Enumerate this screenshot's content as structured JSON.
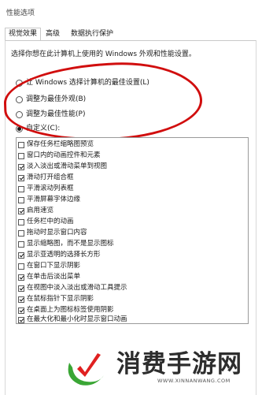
{
  "window": {
    "title": "性能选项"
  },
  "tabs": [
    {
      "label": "视觉效果",
      "active": true
    },
    {
      "label": "高级",
      "active": false
    },
    {
      "label": "数据执行保护",
      "active": false
    }
  ],
  "description": "选择你想在此计算机上使用的 Windows 外观和性能设置。",
  "radio_options": [
    {
      "label": "让 Windows 选择计算机的最佳设置(L)",
      "checked": false
    },
    {
      "label": "调整为最佳外观(B)",
      "checked": false
    },
    {
      "label": "调整为最佳性能(P)",
      "checked": false
    },
    {
      "label": "自定义(C):",
      "checked": true
    }
  ],
  "effects": [
    {
      "label": "保存任务栏缩略图预览",
      "checked": false
    },
    {
      "label": "窗口内的动画控件和元素",
      "checked": false
    },
    {
      "label": "淡入淡出或滑动菜单到视图",
      "checked": true
    },
    {
      "label": "滑动打开组合框",
      "checked": true
    },
    {
      "label": "平滑滚动列表框",
      "checked": false
    },
    {
      "label": "平滑屏幕字体边缘",
      "checked": false
    },
    {
      "label": "启用速览",
      "checked": true
    },
    {
      "label": "任务栏中的动画",
      "checked": false
    },
    {
      "label": "拖动时显示窗口内容",
      "checked": false
    },
    {
      "label": "显示缩略图，而不是显示图标",
      "checked": false
    },
    {
      "label": "显示亚透明的选择长方形",
      "checked": true
    },
    {
      "label": "在窗口下显示阴影",
      "checked": false
    },
    {
      "label": "在单击后淡出菜单",
      "checked": true
    },
    {
      "label": "在视图中淡入淡出或滑动工具提示",
      "checked": true
    },
    {
      "label": "在鼠标指针下显示阴影",
      "checked": true
    },
    {
      "label": "在桌面上为图标标签使用阴影",
      "checked": true
    },
    {
      "label": "在最大化和最小化时显示窗口动画",
      "checked": true
    }
  ],
  "watermark": {
    "text": "消费手游网",
    "url": "WWW.XINNANWANG.COM"
  },
  "colors": {
    "annotation": "#d10e0e",
    "logo_green": "#3aa635",
    "logo_red": "#e02020"
  }
}
